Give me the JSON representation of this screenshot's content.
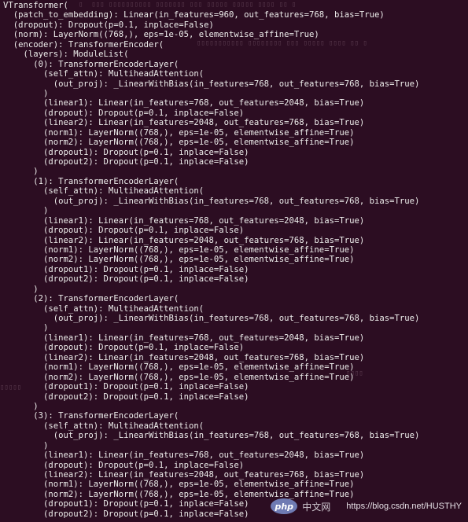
{
  "terminal": {
    "lines": [
      "VTransformer(",
      "  (patch_to_embedding): Linear(in_features=960, out_features=768, bias=True)",
      "  (dropout): Dropout(p=0.1, inplace=False)",
      "  (norm): LayerNorm((768,), eps=1e-05, elementwise_affine=True)",
      "  (encoder): TransformerEncoder(",
      "    (layers): ModuleList(",
      "      (0): TransformerEncoderLayer(",
      "        (self_attn): MultiheadAttention(",
      "          (out_proj): _LinearWithBias(in_features=768, out_features=768, bias=True)",
      "        )",
      "        (linear1): Linear(in_features=768, out_features=2048, bias=True)",
      "        (dropout): Dropout(p=0.1, inplace=False)",
      "        (linear2): Linear(in_features=2048, out_features=768, bias=True)",
      "        (norm1): LayerNorm((768,), eps=1e-05, elementwise_affine=True)",
      "        (norm2): LayerNorm((768,), eps=1e-05, elementwise_affine=True)",
      "        (dropout1): Dropout(p=0.1, inplace=False)",
      "        (dropout2): Dropout(p=0.1, inplace=False)",
      "      )",
      "      (1): TransformerEncoderLayer(",
      "        (self_attn): MultiheadAttention(",
      "          (out_proj): _LinearWithBias(in_features=768, out_features=768, bias=True)",
      "        )",
      "        (linear1): Linear(in_features=768, out_features=2048, bias=True)",
      "        (dropout): Dropout(p=0.1, inplace=False)",
      "        (linear2): Linear(in_features=2048, out_features=768, bias=True)",
      "        (norm1): LayerNorm((768,), eps=1e-05, elementwise_affine=True)",
      "        (norm2): LayerNorm((768,), eps=1e-05, elementwise_affine=True)",
      "        (dropout1): Dropout(p=0.1, inplace=False)",
      "        (dropout2): Dropout(p=0.1, inplace=False)",
      "      )",
      "      (2): TransformerEncoderLayer(",
      "        (self_attn): MultiheadAttention(",
      "          (out_proj): _LinearWithBias(in_features=768, out_features=768, bias=True)",
      "        )",
      "        (linear1): Linear(in_features=768, out_features=2048, bias=True)",
      "        (dropout): Dropout(p=0.1, inplace=False)",
      "        (linear2): Linear(in_features=2048, out_features=768, bias=True)",
      "        (norm1): LayerNorm((768,), eps=1e-05, elementwise_affine=True)",
      "        (norm2): LayerNorm((768,), eps=1e-05, elementwise_affine=True)",
      "        (dropout1): Dropout(p=0.1, inplace=False)",
      "        (dropout2): Dropout(p=0.1, inplace=False)",
      "      )",
      "      (3): TransformerEncoderLayer(",
      "        (self_attn): MultiheadAttention(",
      "          (out_proj): _LinearWithBias(in_features=768, out_features=768, bias=True)",
      "        )",
      "        (linear1): Linear(in_features=768, out_features=2048, bias=True)",
      "        (dropout): Dropout(p=0.1, inplace=False)",
      "        (linear2): Linear(in_features=2048, out_features=768, bias=True)",
      "        (norm1): LayerNorm((768,), eps=1e-05, elementwise_affine=True)",
      "        (norm2): LayerNorm((768,), eps=1e-05, elementwise_affine=True)",
      "        (dropout1): Dropout(p=0.1, inplace=False)",
      "        (dropout2): Dropout(p=0.1, inplace=False)"
    ]
  },
  "watermark": {
    "logo_text": "php",
    "site_text": "中文网",
    "url": "https://blog.csdn.net/HUSTHY"
  },
  "colors": {
    "background": "#2c0d22",
    "foreground": "#eeeeec",
    "php_logo": "#6f7bb3"
  }
}
